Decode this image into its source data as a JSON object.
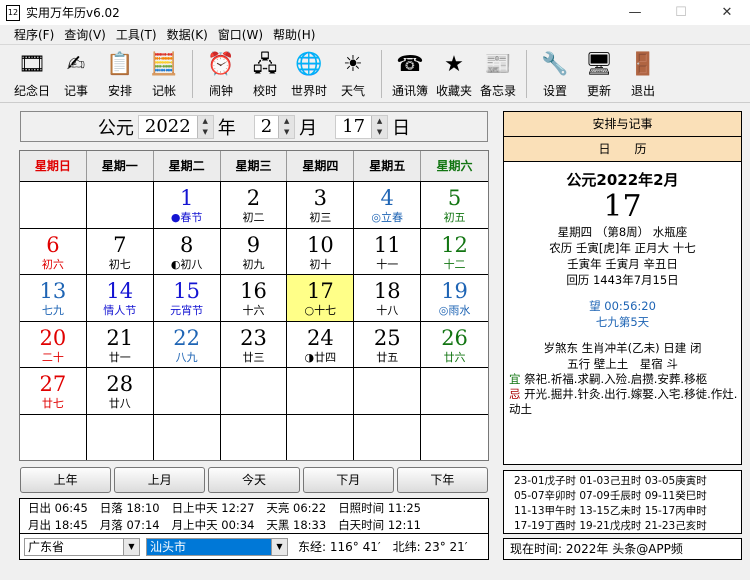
{
  "window": {
    "title": "实用万年历v6.02",
    "minimize": "—",
    "maximize": "☐",
    "close": "✕"
  },
  "menu": [
    "程序(F)",
    "查询(V)",
    "工具(T)",
    "数据(K)",
    "窗口(W)",
    "帮助(H)"
  ],
  "toolbar": [
    [
      {
        "label": "纪念日",
        "icon": "🎞"
      },
      {
        "label": "记事",
        "icon": "✍"
      },
      {
        "label": "安排",
        "icon": "📋"
      },
      {
        "label": "记帐",
        "icon": "🧮"
      }
    ],
    [
      {
        "label": "闹钟",
        "icon": "⏰"
      },
      {
        "label": "校时",
        "icon": "🖧"
      },
      {
        "label": "世界时",
        "icon": "🌐"
      },
      {
        "label": "天气",
        "icon": "☀"
      }
    ],
    [
      {
        "label": "通讯簿",
        "icon": "☎"
      },
      {
        "label": "收藏夹",
        "icon": "★"
      },
      {
        "label": "备忘录",
        "icon": "📰"
      }
    ],
    [
      {
        "label": "设置",
        "icon": "🔧"
      },
      {
        "label": "更新",
        "icon": "🖥"
      },
      {
        "label": "退出",
        "icon": "🚪"
      }
    ]
  ],
  "date": {
    "era": "公元",
    "year": "2022",
    "year_unit": "年",
    "month": "2",
    "month_unit": "月",
    "day": "17",
    "day_unit": "日"
  },
  "colors": {
    "sun": "#e00000",
    "sat": "#127512",
    "term": "#1e64b4",
    "fest": "#1414d2",
    "norm": "#000000",
    "today_bg": "#ffff88"
  },
  "weekdays": [
    {
      "label": "星期日",
      "c": "sun"
    },
    {
      "label": "星期一",
      "c": "norm"
    },
    {
      "label": "星期二",
      "c": "norm"
    },
    {
      "label": "星期三",
      "c": "norm"
    },
    {
      "label": "星期四",
      "c": "norm"
    },
    {
      "label": "星期五",
      "c": "norm"
    },
    {
      "label": "星期六",
      "c": "sat"
    }
  ],
  "cells": [
    {
      "d": "",
      "l": ""
    },
    {
      "d": "",
      "l": ""
    },
    {
      "d": "1",
      "l": "●春节",
      "c": "fest"
    },
    {
      "d": "2",
      "l": "初二"
    },
    {
      "d": "3",
      "l": "初三"
    },
    {
      "d": "4",
      "l": "◎立春",
      "c": "term"
    },
    {
      "d": "5",
      "l": "初五",
      "c": "sat"
    },
    {
      "d": "6",
      "l": "初六",
      "c": "sun"
    },
    {
      "d": "7",
      "l": "初七"
    },
    {
      "d": "8",
      "l": "◐初八"
    },
    {
      "d": "9",
      "l": "初九"
    },
    {
      "d": "10",
      "l": "初十"
    },
    {
      "d": "11",
      "l": "十一"
    },
    {
      "d": "12",
      "l": "十二",
      "c": "sat"
    },
    {
      "d": "13",
      "l": "七九",
      "c": "term"
    },
    {
      "d": "14",
      "l": "情人节",
      "c": "fest"
    },
    {
      "d": "15",
      "l": "元宵节",
      "c": "fest"
    },
    {
      "d": "16",
      "l": "十六"
    },
    {
      "d": "17",
      "l": "○十七",
      "today": true
    },
    {
      "d": "18",
      "l": "十八"
    },
    {
      "d": "19",
      "l": "◎雨水",
      "c": "term"
    },
    {
      "d": "20",
      "l": "二十",
      "c": "sun"
    },
    {
      "d": "21",
      "l": "廿一"
    },
    {
      "d": "22",
      "l": "八九",
      "c": "term"
    },
    {
      "d": "23",
      "l": "廿三"
    },
    {
      "d": "24",
      "l": "◑廿四"
    },
    {
      "d": "25",
      "l": "廿五"
    },
    {
      "d": "26",
      "l": "廿六",
      "c": "sat"
    },
    {
      "d": "27",
      "l": "廿七",
      "c": "sun"
    },
    {
      "d": "28",
      "l": "廿八"
    },
    {
      "d": "",
      "l": ""
    },
    {
      "d": "",
      "l": ""
    },
    {
      "d": "",
      "l": ""
    },
    {
      "d": "",
      "l": ""
    },
    {
      "d": "",
      "l": ""
    },
    {
      "d": "",
      "l": ""
    },
    {
      "d": "",
      "l": ""
    },
    {
      "d": "",
      "l": ""
    },
    {
      "d": "",
      "l": ""
    },
    {
      "d": "",
      "l": ""
    },
    {
      "d": "",
      "l": ""
    },
    {
      "d": "",
      "l": ""
    }
  ],
  "nav": [
    "上年",
    "上月",
    "今天",
    "下月",
    "下年"
  ],
  "sun": {
    "row1": [
      "日出 06:45",
      "日落 18:10",
      "日上中天 12:27",
      "天亮 06:22",
      "日照时间 11:25"
    ],
    "row2": [
      "月出 18:45",
      "月落 07:14",
      "月上中天 00:34",
      "天黑 18:33",
      "白天时间 12:11"
    ]
  },
  "location": {
    "province": "广东省",
    "city": "汕头市",
    "lon": "东经: 116° 41′",
    "lat": "北纬: 23° 21′"
  },
  "panel": {
    "tab1": "安排与记事",
    "tab2": "日　　历",
    "ym": "公元2022年2月",
    "day": "17",
    "l1": "星期四 （第8周） 水瓶座",
    "l2": "农历 壬寅[虎]年 正月大 十七",
    "l3": "壬寅年 壬寅月 辛丑日",
    "l4": "回历 1443年7月15日",
    "moon": "望 00:56:20",
    "nine": "七九第5天",
    "l5": "岁煞东 生肖冲羊(乙未) 日建 闭",
    "l6": "五行 壁上土　星宿 斗",
    "yi_label": "宜",
    "yi": "祭祀.祈福.求嗣.入殓.启攒.安葬.移柩",
    "ji_label": "忌",
    "ji": "开光.掘井.针灸.出行.嫁娶.入宅.移徙.作灶.动土"
  },
  "hours": [
    "23-01戊子时 01-03己丑时 03-05庚寅时",
    "05-07辛卯时 07-09壬辰时 09-11癸巳时",
    "11-13甲午时 13-15乙未时 15-17丙申时",
    "17-19丁酉时 19-21戊戌时 21-23己亥时"
  ],
  "now": "现在时间: 2022年 头条@APP频"
}
